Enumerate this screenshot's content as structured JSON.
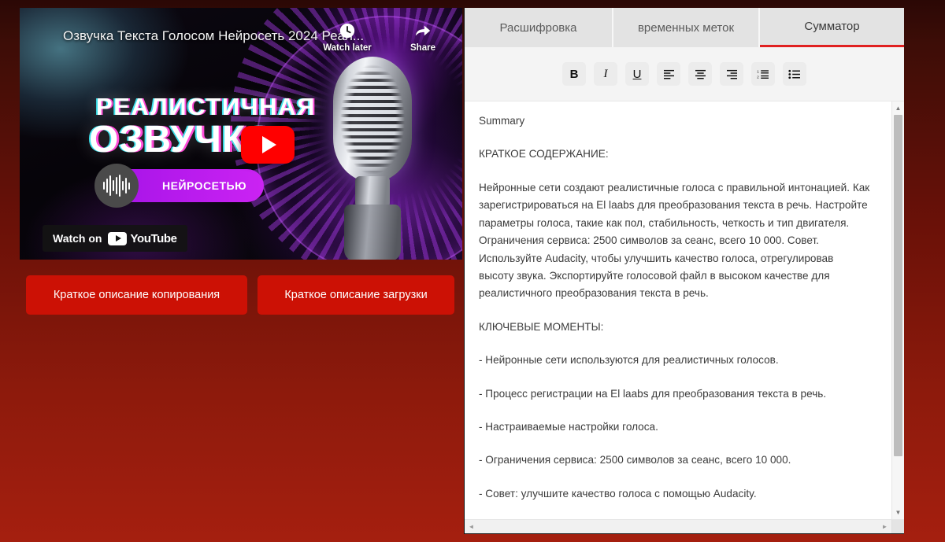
{
  "video": {
    "title": "Озвучка Текста Голосом Нейросеть 2024 Реал...",
    "watch_later_label": "Watch later",
    "share_label": "Share",
    "hero_line1": "РЕАЛИСТИЧНАЯ",
    "hero_line2": "ОЗВУЧКА",
    "hero_pill": "НЕЙРОСЕТЬЮ",
    "watch_on_label": "Watch on",
    "youtube_label": "YouTube"
  },
  "buttons": {
    "copy_summary": "Краткое описание копирования",
    "download_summary": "Краткое описание загрузки",
    "color": "#cc1105"
  },
  "panel": {
    "tabs": [
      {
        "label": "Расшифровка",
        "active": false
      },
      {
        "label": "временных меток",
        "active": false
      },
      {
        "label": "Сумматор",
        "active": true
      }
    ],
    "active_tab_accent": "#e02020",
    "toolbar": [
      {
        "name": "bold-icon",
        "label": "B"
      },
      {
        "name": "italic-icon",
        "label": "I"
      },
      {
        "name": "underline-icon",
        "label": "U"
      },
      {
        "name": "align-left-icon",
        "label": ""
      },
      {
        "name": "align-center-icon",
        "label": ""
      },
      {
        "name": "align-right-icon",
        "label": ""
      },
      {
        "name": "ordered-list-icon",
        "label": ""
      },
      {
        "name": "bullet-list-icon",
        "label": ""
      }
    ],
    "document": {
      "heading": "Summary",
      "section1_title": "КРАТКОЕ СОДЕРЖАНИЕ:",
      "section1_body": "Нейронные сети создают реалистичные голоса с правильной интонацией. Как зарегистрироваться на El laabs для преобразования текста в речь. Настройте параметры голоса, такие как пол, стабильность, четкость и тип двигателя. Ограничения сервиса: 2500 символов за сеанс, всего 10 000. Совет. Используйте Audacity, чтобы улучшить качество голоса, отрегулировав высоту звука. Экспортируйте голосовой файл в высоком качестве для реалистичного преобразования текста в речь.",
      "section2_title": "КЛЮЧЕВЫЕ МОМЕНТЫ:",
      "bullets": [
        "- Нейронные сети используются для реалистичных голосов.",
        "- Процесс регистрации на El laabs для преобразования текста в речь.",
        "- Настраиваемые настройки голоса.",
        "- Ограничения сервиса: 2500 символов за сеанс, всего 10 000.",
        "- Совет: улучшите качество голоса с помощью Audacity."
      ]
    },
    "scroll_up_glyph": "▲",
    "scroll_down_glyph": "▼",
    "scroll_left_glyph": "◄",
    "scroll_right_glyph": "►"
  }
}
